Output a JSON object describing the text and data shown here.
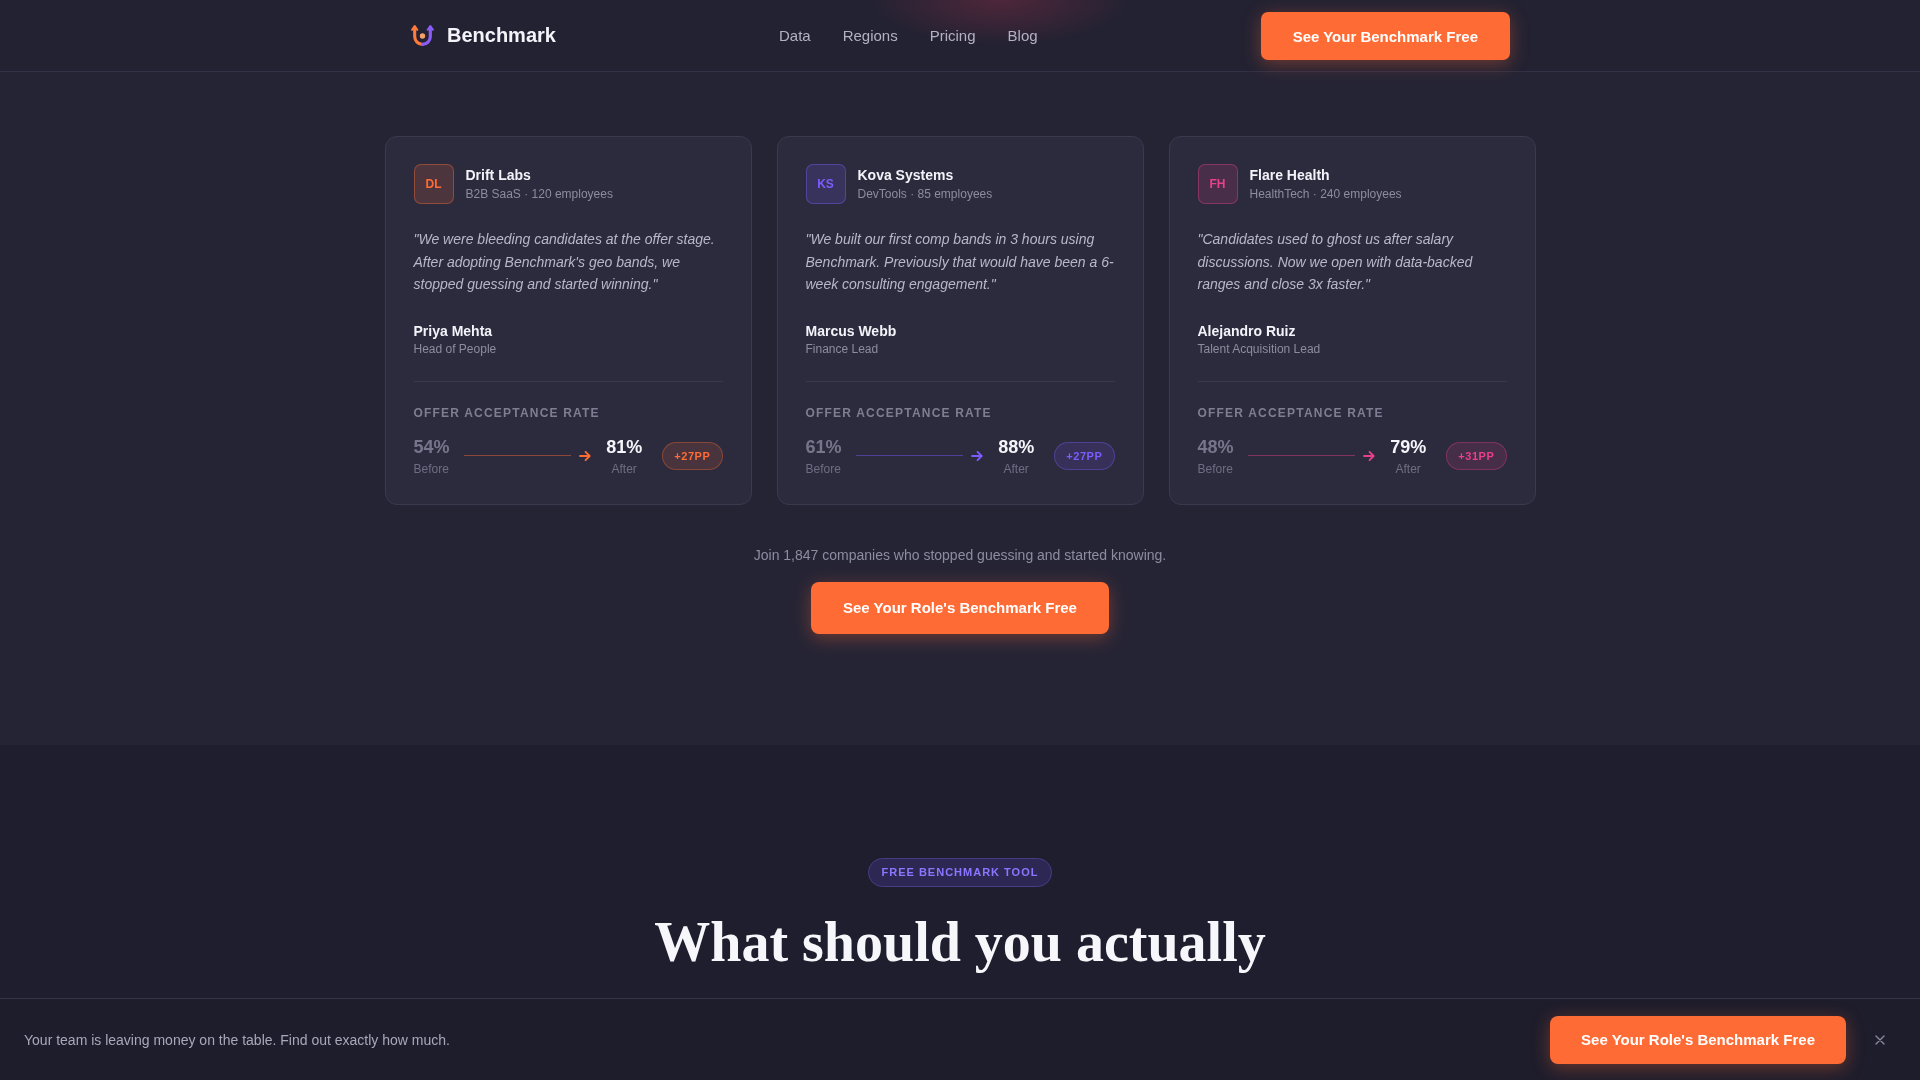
{
  "header": {
    "brand": "Benchmark",
    "nav": [
      {
        "label": "Data"
      },
      {
        "label": "Regions"
      },
      {
        "label": "Pricing"
      },
      {
        "label": "Blog"
      }
    ],
    "cta": "See Your Benchmark Free"
  },
  "testimonials": [
    {
      "initials": "DL",
      "company": "Drift Labs",
      "meta": "B2B SaaS · 120 employees",
      "color": "#ff6b35",
      "quote": "\"We were bleeding candidates at the offer stage. After adopting Benchmark's geo bands, we stopped guessing and started winning.\"",
      "person": "Priya Mehta",
      "role": "Head of People",
      "metric": {
        "label": "OFFER ACCEPTANCE RATE",
        "before": "54%",
        "before_label": "Before",
        "after": "81%",
        "after_label": "After",
        "change": "+27PP"
      }
    },
    {
      "initials": "KS",
      "company": "Kova Systems",
      "meta": "DevTools · 85 employees",
      "color": "#7c5cff",
      "quote": "\"We built our first comp bands in 3 hours using Benchmark. Previously that would have been a 6-week consulting engagement.\"",
      "person": "Marcus Webb",
      "role": "Finance Lead",
      "metric": {
        "label": "OFFER ACCEPTANCE RATE",
        "before": "61%",
        "before_label": "Before",
        "after": "88%",
        "after_label": "After",
        "change": "+27PP"
      }
    },
    {
      "initials": "FH",
      "company": "Flare Health",
      "meta": "HealthTech · 240 employees",
      "color": "#e8408a",
      "quote": "\"Candidates used to ghost us after salary discussions. Now we open with data-backed ranges and close 3x faster.\"",
      "person": "Alejandro Ruiz",
      "role": "Talent Acquisition Lead",
      "metric": {
        "label": "OFFER ACCEPTANCE RATE",
        "before": "48%",
        "before_label": "Before",
        "after": "79%",
        "after_label": "After",
        "change": "+31PP"
      }
    }
  ],
  "social_proof": "Join 1,847 companies who stopped guessing and started knowing.",
  "cta": "See Your Role's Benchmark Free",
  "tool_section": {
    "badge": "FREE BENCHMARK TOOL",
    "heading": "What should you actually"
  },
  "sticky_banner": {
    "message": "Your team is leaving money on the table. Find out exactly how much.",
    "button": "See Your Role's Benchmark Free"
  }
}
